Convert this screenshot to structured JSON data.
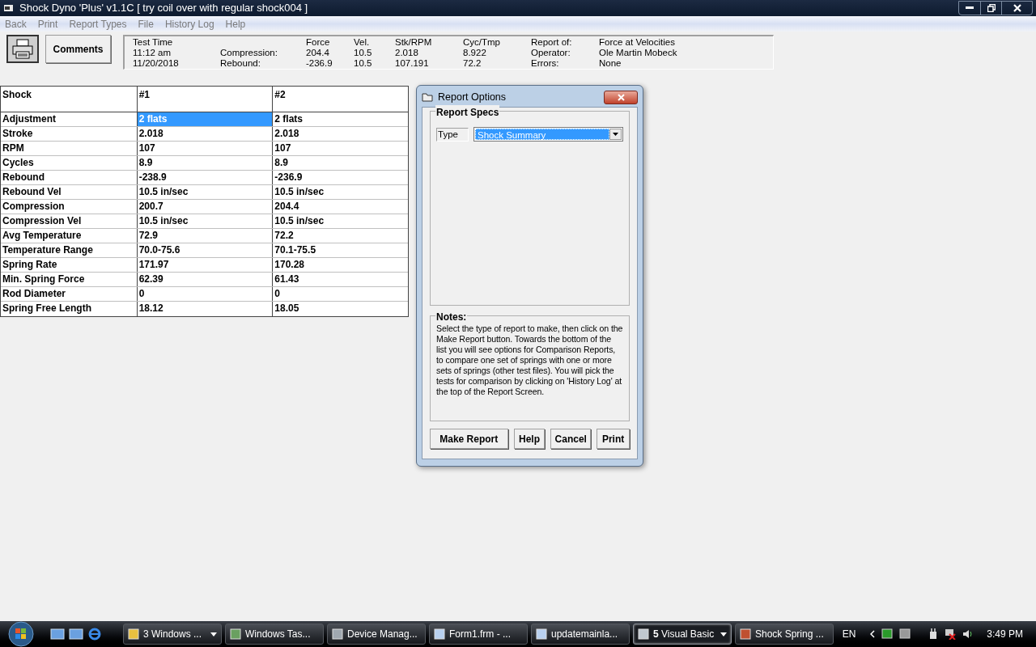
{
  "window": {
    "title": "Shock Dyno 'Plus' v1.1C  [ try coil over with regular shock004 ]"
  },
  "menu": [
    "Back",
    "Print",
    "Report Types",
    "File",
    "History Log",
    "Help"
  ],
  "toolbar": {
    "comments_button": "Comments"
  },
  "info": {
    "columns": [
      {
        "heading": "Test Time",
        "lines": [
          "11:12 am",
          "11/20/2018"
        ]
      },
      {
        "lines": [
          "Compression:",
          "Rebound:"
        ]
      },
      {
        "heading": "Force",
        "lines": [
          "204.4",
          "-236.9"
        ]
      },
      {
        "heading": "Vel.",
        "lines": [
          "10.5",
          "10.5"
        ]
      },
      {
        "heading": "Stk/RPM",
        "lines": [
          "2.018",
          "107.191"
        ]
      },
      {
        "heading": "Cyc/Tmp",
        "lines": [
          "8.922",
          "72.2"
        ]
      },
      {
        "heading": "Report of:",
        "lines": [
          "Operator:",
          "Errors:"
        ]
      },
      {
        "heading": "Force at Velocities",
        "lines": [
          "Ole Martin Mobeck",
          "None"
        ]
      }
    ]
  },
  "table": {
    "columns": [
      "Shock",
      "#1",
      "#2"
    ],
    "rows": [
      {
        "cells": [
          {
            "text": "Adjustment",
            "selected": false
          },
          {
            "text": "2 flats",
            "selected": true
          },
          {
            "text": "2 flats",
            "selected": false
          }
        ]
      },
      {
        "cells": [
          {
            "text": "Stroke",
            "selected": false
          },
          {
            "text": "2.018",
            "selected": false
          },
          {
            "text": "2.018",
            "selected": false
          }
        ]
      },
      {
        "cells": [
          {
            "text": "RPM",
            "selected": false
          },
          {
            "text": "107",
            "selected": false
          },
          {
            "text": "107",
            "selected": false
          }
        ]
      },
      {
        "cells": [
          {
            "text": "Cycles",
            "selected": false
          },
          {
            "text": "8.9",
            "selected": false
          },
          {
            "text": "8.9",
            "selected": false
          }
        ]
      },
      {
        "cells": [
          {
            "text": "Rebound",
            "selected": false
          },
          {
            "text": "-238.9",
            "selected": false
          },
          {
            "text": "-236.9",
            "selected": false
          }
        ]
      },
      {
        "cells": [
          {
            "text": "Rebound Vel",
            "selected": false
          },
          {
            "text": "10.5 in/sec",
            "selected": false
          },
          {
            "text": "10.5 in/sec",
            "selected": false
          }
        ]
      },
      {
        "cells": [
          {
            "text": "Compression",
            "selected": false
          },
          {
            "text": "200.7",
            "selected": false
          },
          {
            "text": "204.4",
            "selected": false
          }
        ]
      },
      {
        "cells": [
          {
            "text": "Compression Vel",
            "selected": false
          },
          {
            "text": "10.5 in/sec",
            "selected": false
          },
          {
            "text": "10.5 in/sec",
            "selected": false
          }
        ]
      },
      {
        "cells": [
          {
            "text": "Avg Temperature",
            "selected": false
          },
          {
            "text": "72.9",
            "selected": false
          },
          {
            "text": "72.2",
            "selected": false
          }
        ]
      },
      {
        "cells": [
          {
            "text": "Temperature Range",
            "selected": false
          },
          {
            "text": "70.0-75.6",
            "selected": false
          },
          {
            "text": "70.1-75.5",
            "selected": false
          }
        ]
      },
      {
        "cells": [
          {
            "text": "Spring Rate",
            "selected": false
          },
          {
            "text": "171.97",
            "selected": false
          },
          {
            "text": "170.28",
            "selected": false
          }
        ]
      },
      {
        "cells": [
          {
            "text": "Min. Spring Force",
            "selected": false
          },
          {
            "text": "62.39",
            "selected": false
          },
          {
            "text": "61.43",
            "selected": false
          }
        ]
      },
      {
        "cells": [
          {
            "text": "Rod Diameter",
            "selected": false
          },
          {
            "text": "0",
            "selected": false
          },
          {
            "text": "0",
            "selected": false
          }
        ]
      },
      {
        "cells": [
          {
            "text": "Spring Free Length",
            "selected": false
          },
          {
            "text": "18.12",
            "selected": false
          },
          {
            "text": "18.05",
            "selected": false
          }
        ]
      }
    ]
  },
  "dialog": {
    "title": "Report Options",
    "specs_group": "Report Specs",
    "type_label": "Type",
    "type_value": "Shock Summary",
    "notes_group": "Notes:",
    "notes": "Select the type of report to make, then click on the Make Report button.  Towards the bottom of the list you will see options for Comparison Reports, to compare one set of springs with one or more sets of springs (other test files).  You will pick the tests for comparison by clicking on 'History Log' at the top of the Report Screen.",
    "buttons": [
      "Make Report",
      "Help",
      "Cancel",
      "Print"
    ]
  },
  "taskbar": {
    "tasks": [
      {
        "label": "3 Windows ...",
        "grouped": true,
        "selected": false
      },
      {
        "label": "Windows Tas...",
        "grouped": false,
        "selected": false
      },
      {
        "label": "Device Manag...",
        "grouped": false,
        "selected": false
      },
      {
        "label": "Form1.frm - ...",
        "grouped": false,
        "selected": false
      },
      {
        "label": "updatemainla...",
        "grouped": false,
        "selected": false
      },
      {
        "label": "**5** Visual Basic",
        "grouped": true,
        "selected": true
      },
      {
        "label": "Shock Spring ...",
        "grouped": false,
        "selected": false
      }
    ],
    "language": "EN",
    "clock": "3:49 PM"
  }
}
